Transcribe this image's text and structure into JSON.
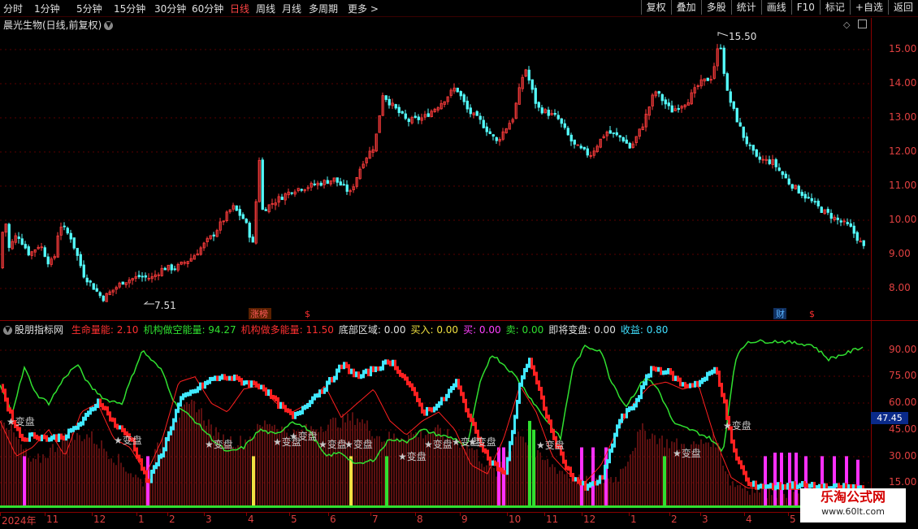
{
  "toolbar": {
    "periods": [
      "分时",
      "1分钟",
      "5分钟",
      "15分钟",
      "30分钟",
      "60分钟",
      "日线",
      "周线",
      "月线",
      "多周期",
      "更多 >"
    ],
    "active": "日线",
    "right_buttons": [
      "复权",
      "叠加",
      "多股",
      "统计",
      "画线",
      "F10",
      "标记",
      "+自选",
      "返回"
    ]
  },
  "main": {
    "title": "晨光生物(日线,前复权)",
    "high_label": "15.50",
    "low_label": "7.51",
    "yaxis": [
      "15.00",
      "14.00",
      "13.00",
      "12.00",
      "11.00",
      "10.00",
      "9.00",
      "8.00"
    ],
    "event_tags": [
      {
        "text": "涨榜",
        "color": "#ff5a5a"
      },
      {
        "text": "$",
        "color": "#ff3030"
      },
      {
        "text": "财",
        "color": "#5ab4ff"
      },
      {
        "text": "$",
        "color": "#ff3030"
      }
    ]
  },
  "sub": {
    "title": "股朋指标网",
    "items": [
      {
        "label": "生命量能:",
        "value": "2.10",
        "color": "#ff3030"
      },
      {
        "label": "机构做空能量:",
        "value": "94.27",
        "color": "#30e030"
      },
      {
        "label": "机构做多能量:",
        "value": "11.50",
        "color": "#ff3030"
      },
      {
        "label": "底部区域:",
        "value": "0.00",
        "color": "#e0e0e0"
      },
      {
        "label": "买入:",
        "value": "0.00",
        "color": "#f0e040"
      },
      {
        "label": "买:",
        "value": "0.00",
        "color": "#ff40ff"
      },
      {
        "label": "卖:",
        "value": "0.00",
        "color": "#30e030"
      },
      {
        "label": "即将变盘:",
        "value": "0.00",
        "color": "#e0e0e0"
      },
      {
        "label": "收益:",
        "value": "0.80",
        "color": "#40e0ff"
      }
    ],
    "yaxis": [
      "90.00",
      "75.00",
      "60.00",
      "45.00",
      "30.00",
      "15.00"
    ],
    "current_value": "47.45",
    "bianpan": "★变盘"
  },
  "dates": [
    "2024年",
    "11",
    "12",
    "1",
    "2",
    "3",
    "4",
    "5",
    "6",
    "7",
    "8",
    "9",
    "10",
    "11",
    "12",
    "1",
    "2",
    "3",
    "4",
    "5"
  ],
  "watermark": {
    "line1": "乐淘公式网",
    "line2": "www.60lt.com"
  },
  "colors": {
    "up": "#ff3c3c",
    "down": "#54ffff",
    "frame": "#8a0000",
    "green": "#30e030",
    "cyan": "#40e8ff",
    "magenta": "#ff30ff"
  }
}
